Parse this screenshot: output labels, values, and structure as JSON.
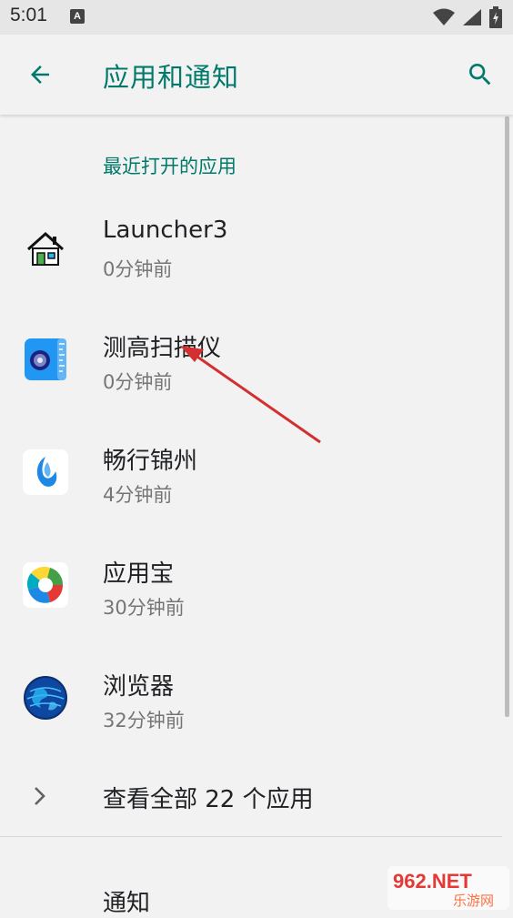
{
  "status_bar": {
    "time": "5:01",
    "notification_icon_letter": "A",
    "icons": [
      "wifi-icon",
      "signal-icon",
      "battery-icon"
    ]
  },
  "app_bar": {
    "title": "应用和通知",
    "back_icon": "arrow-back-icon",
    "search_icon": "search-icon",
    "accent_color": "#00796b"
  },
  "recent": {
    "header": "最近打开的应用",
    "apps": [
      {
        "name": "Launcher3",
        "time": "0分钟前",
        "icon": "launcher-house-icon"
      },
      {
        "name": "测高扫描仪",
        "time": "0分钟前",
        "icon": "height-scanner-icon"
      },
      {
        "name": "畅行锦州",
        "time": "4分钟前",
        "icon": "changxing-jinzhou-icon"
      },
      {
        "name": "应用宝",
        "time": "30分钟前",
        "icon": "yingyongbao-icon"
      },
      {
        "name": "浏览器",
        "time": "32分钟前",
        "icon": "browser-globe-icon"
      }
    ]
  },
  "see_all": {
    "label": "查看全部 22 个应用"
  },
  "notifications": {
    "label": "通知"
  },
  "watermark": {
    "text_top": "962.NET",
    "text_bottom": "乐游网"
  }
}
